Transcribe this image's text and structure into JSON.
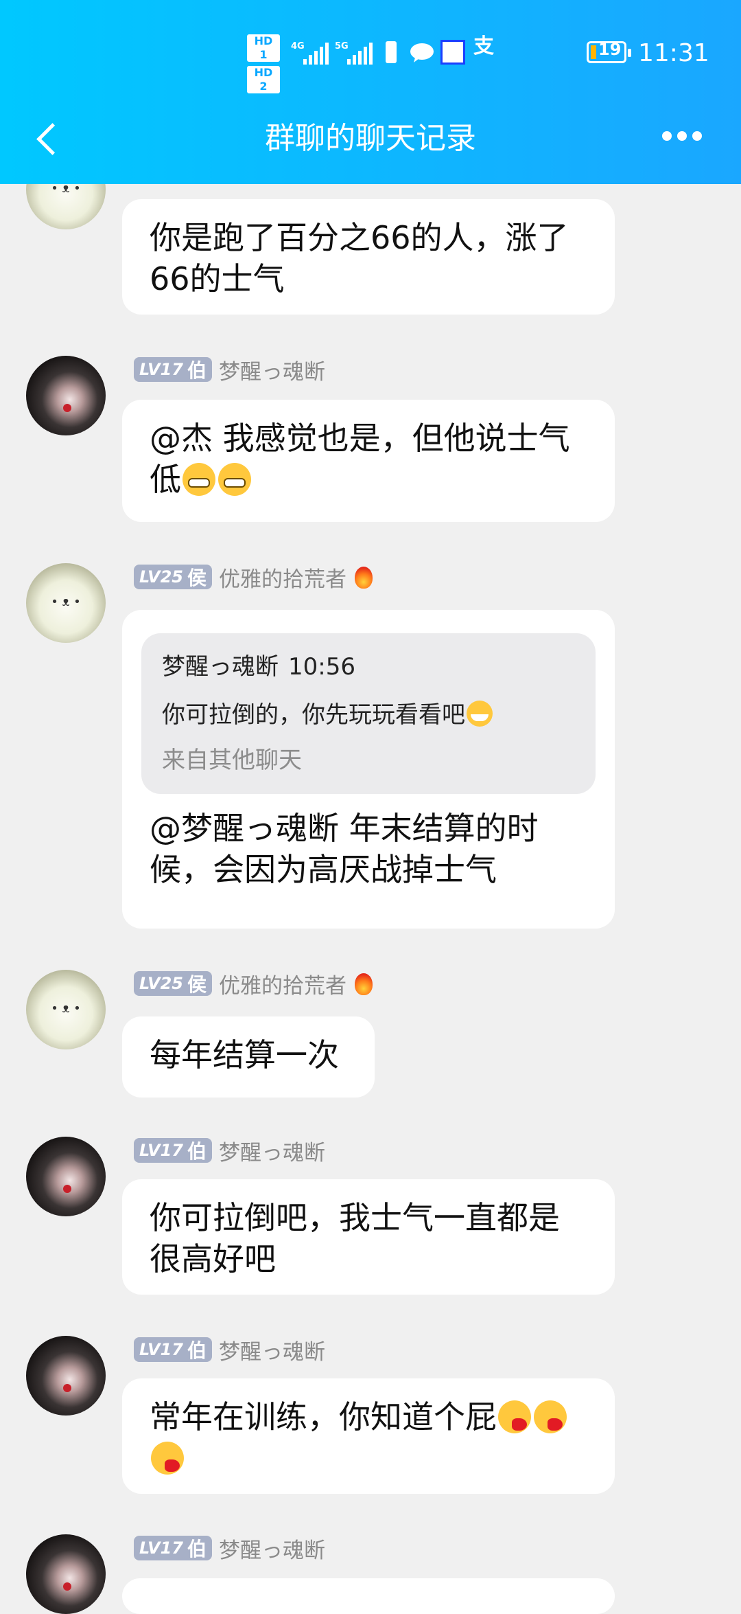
{
  "status_bar": {
    "hd1": "HD 1",
    "hd2": "HD 2",
    "net1": "4G",
    "net2": "5G",
    "pay_icon_char": "支",
    "battery": "19",
    "time": "11:31"
  },
  "header": {
    "title": "群聊的聊天记录"
  },
  "messages": [
    {
      "avatar": "bear-avatar",
      "text": "你是跑了百分之66的人，涨了66的士气"
    },
    {
      "avatar": "dark-hair-avatar",
      "level": "LV17",
      "rank": "伯",
      "nickname": "梦醒っ魂断",
      "text": "@杰 我感觉也是，但他说士气低",
      "emojis": [
        "grin-emoji",
        "grin-emoji"
      ]
    },
    {
      "avatar": "bear-avatar",
      "level": "LV25",
      "rank": "侯",
      "nickname": "优雅的拾荒者",
      "flame_icon": "flame-icon",
      "quote": {
        "author": "梦醒っ魂断",
        "time": "10:56",
        "text": "你可拉倒的，你先玩玩看看吧",
        "source": "来自其他聊天"
      },
      "text": "@梦醒っ魂断 年末结算的时候，会因为高厌战掉士气"
    },
    {
      "avatar": "bear-avatar",
      "level": "LV25",
      "rank": "侯",
      "nickname": "优雅的拾荒者",
      "flame_icon": "flame-icon",
      "text": "每年结算一次"
    },
    {
      "avatar": "dark-hair-avatar",
      "level": "LV17",
      "rank": "伯",
      "nickname": "梦醒っ魂断",
      "text": "你可拉倒吧，我士气一直都是很高好吧"
    },
    {
      "avatar": "dark-hair-avatar",
      "level": "LV17",
      "rank": "伯",
      "nickname": "梦醒っ魂断",
      "text": "常年在训练，你知道个屁",
      "emojis": [
        "tongue-emoji",
        "tongue-emoji",
        "tongue-emoji"
      ]
    },
    {
      "avatar": "dark-hair-avatar",
      "level": "LV17",
      "rank": "伯",
      "nickname": "梦醒っ魂断",
      "text": ""
    }
  ]
}
